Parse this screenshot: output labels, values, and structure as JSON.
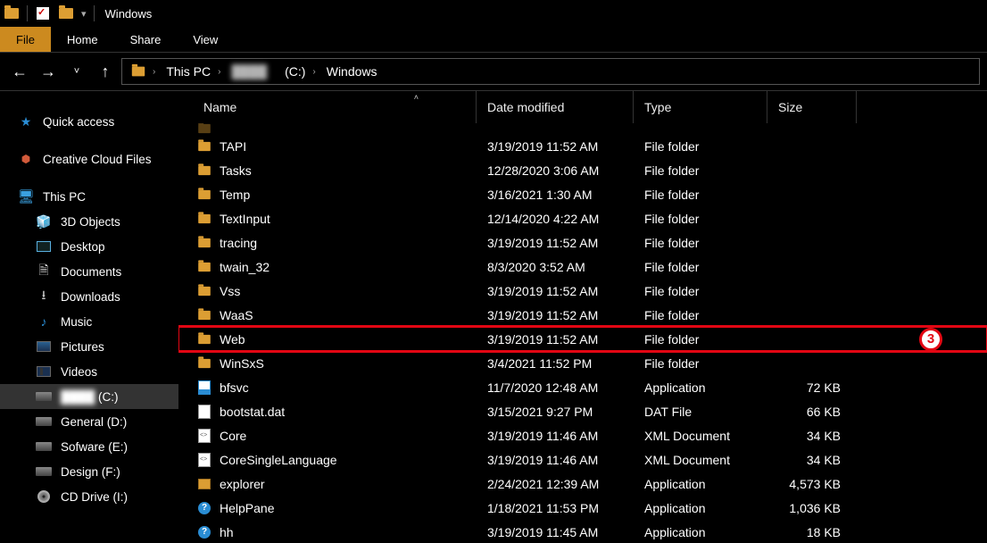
{
  "window": {
    "title": "Windows"
  },
  "ribbon": {
    "file": "File",
    "home": "Home",
    "share": "Share",
    "view": "View"
  },
  "address": {
    "root": "This PC",
    "drive": "(C:)",
    "drive_blur": "████",
    "folder": "Windows"
  },
  "sidebar": {
    "quick_access": "Quick access",
    "creative_cloud": "Creative Cloud Files",
    "this_pc": "This PC",
    "children": [
      {
        "label": "3D Objects"
      },
      {
        "label": "Desktop"
      },
      {
        "label": "Documents"
      },
      {
        "label": "Downloads"
      },
      {
        "label": "Music"
      },
      {
        "label": "Pictures"
      },
      {
        "label": "Videos"
      },
      {
        "label": "(C:)",
        "blur_prefix": true,
        "selected": true
      },
      {
        "label": "General (D:)"
      },
      {
        "label": "Sofware (E:)"
      },
      {
        "label": "Design (F:)"
      },
      {
        "label": "CD Drive (I:)"
      }
    ]
  },
  "columns": {
    "name": "Name",
    "date": "Date modified",
    "type": "Type",
    "size": "Size"
  },
  "rows": [
    {
      "name": "TAPI",
      "date": "3/19/2019 11:52 AM",
      "type": "File folder",
      "size": "",
      "icon": "folder"
    },
    {
      "name": "Tasks",
      "date": "12/28/2020 3:06 AM",
      "type": "File folder",
      "size": "",
      "icon": "folder"
    },
    {
      "name": "Temp",
      "date": "3/16/2021 1:30 AM",
      "type": "File folder",
      "size": "",
      "icon": "folder"
    },
    {
      "name": "TextInput",
      "date": "12/14/2020 4:22 AM",
      "type": "File folder",
      "size": "",
      "icon": "folder"
    },
    {
      "name": "tracing",
      "date": "3/19/2019 11:52 AM",
      "type": "File folder",
      "size": "",
      "icon": "folder"
    },
    {
      "name": "twain_32",
      "date": "8/3/2020 3:52 AM",
      "type": "File folder",
      "size": "",
      "icon": "folder"
    },
    {
      "name": "Vss",
      "date": "3/19/2019 11:52 AM",
      "type": "File folder",
      "size": "",
      "icon": "folder"
    },
    {
      "name": "WaaS",
      "date": "3/19/2019 11:52 AM",
      "type": "File folder",
      "size": "",
      "icon": "folder"
    },
    {
      "name": "Web",
      "date": "3/19/2019 11:52 AM",
      "type": "File folder",
      "size": "",
      "icon": "folder",
      "highlight": true
    },
    {
      "name": "WinSxS",
      "date": "3/4/2021 11:52 PM",
      "type": "File folder",
      "size": "",
      "icon": "folder"
    },
    {
      "name": "bfsvc",
      "date": "11/7/2020 12:48 AM",
      "type": "Application",
      "size": "72 KB",
      "icon": "app"
    },
    {
      "name": "bootstat.dat",
      "date": "3/15/2021 9:27 PM",
      "type": "DAT File",
      "size": "66 KB",
      "icon": "dat"
    },
    {
      "name": "Core",
      "date": "3/19/2019 11:46 AM",
      "type": "XML Document",
      "size": "34 KB",
      "icon": "xml"
    },
    {
      "name": "CoreSingleLanguage",
      "date": "3/19/2019 11:46 AM",
      "type": "XML Document",
      "size": "34 KB",
      "icon": "xml"
    },
    {
      "name": "explorer",
      "date": "2/24/2021 12:39 AM",
      "type": "Application",
      "size": "4,573 KB",
      "icon": "explorer"
    },
    {
      "name": "HelpPane",
      "date": "1/18/2021 11:53 PM",
      "type": "Application",
      "size": "1,036 KB",
      "icon": "help"
    },
    {
      "name": "hh",
      "date": "3/19/2019 11:45 AM",
      "type": "Application",
      "size": "18 KB",
      "icon": "help"
    }
  ],
  "annotation": {
    "number": "3"
  }
}
